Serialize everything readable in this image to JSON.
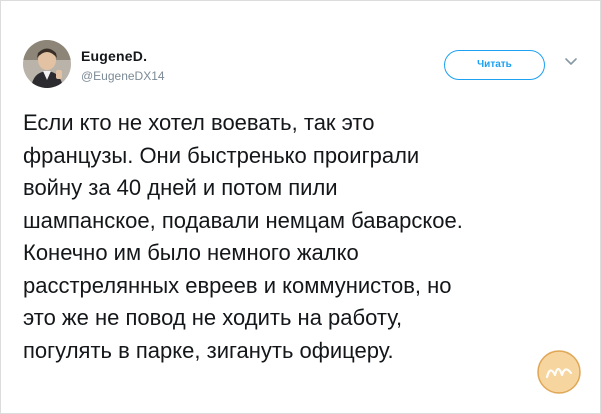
{
  "tweet": {
    "author_name": "EugeneD.",
    "author_handle": "@EugeneDX14",
    "follow_label": "Читать",
    "text_lines": [
      "Если кто не хотел воевать, так это",
      "французы. Они быстренько проиграли",
      "войну за 40 дней и потом пили",
      "шампанское, подавали немцам баварское.",
      "Конечно им было немного жалко",
      "расстрелянных евреев и коммунистов, но",
      "это же не повод не ходить на работу,",
      "погулять в парке, зигануть офицеру."
    ]
  },
  "icons": {
    "caret": "chevron-down-icon",
    "watermark": "watermark-logo"
  },
  "colors": {
    "accent": "#1da1f2",
    "text": "#14171a",
    "muted": "#7b8a96",
    "watermark": "#e8a94a"
  }
}
